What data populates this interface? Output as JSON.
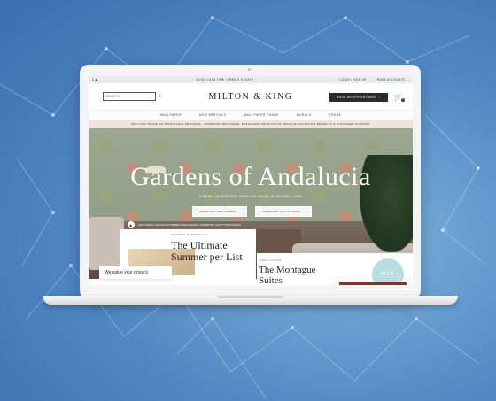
{
  "promo_bar": {
    "lang": "£  ▣",
    "message": "♡ QUICK LEAD TIME | FREE U.S. DAYS ♡",
    "login": "LOGIN / SIGN UP",
    "trade": "TRADE ACCOUNTS →"
  },
  "header": {
    "search_placeholder": "SEARCH",
    "logo": "MILTON & KING",
    "book_button": "BOOK AN APPOINTMENT →",
    "cart_count": "0"
  },
  "nav": {
    "items": [
      "WALLPAPER",
      "NEW ARRIVALS",
      "WALLPAPER TRADE",
      "MURALS",
      "TRADE"
    ]
  },
  "trade_banner": "JOIN OUR TRADE OR WHOLESALE PROGRAM – INTERIOR DESIGNERS, RETAILERS, ARCHITECTS. RECEIVE EXCLUSIVE BENEFITS & CUSTOMER SUPPORT",
  "hero": {
    "title": "Gardens of Andalucia",
    "subtitle": "A RETAIL INTRODUCED FROM THE HOUSE OF MILTON & KING",
    "button_wallpaper": "SHOP THE WALLPAPER →",
    "button_collection": "SHOP THE COLLECTION →",
    "featuring": "FEATURING: MILTON ALHAMBRA WALLPAPER | SEVENTIC LIGHT COLOURWAY"
  },
  "cards": {
    "left_tag": "ULTIMATE SUMMER LIST",
    "left_title": "The Ultimate Summer per List",
    "right_tag": "GUEST SUITES",
    "right_title": "The Montague Suites",
    "badge": "MLK"
  },
  "privacy": {
    "text": "We value your privacy"
  }
}
